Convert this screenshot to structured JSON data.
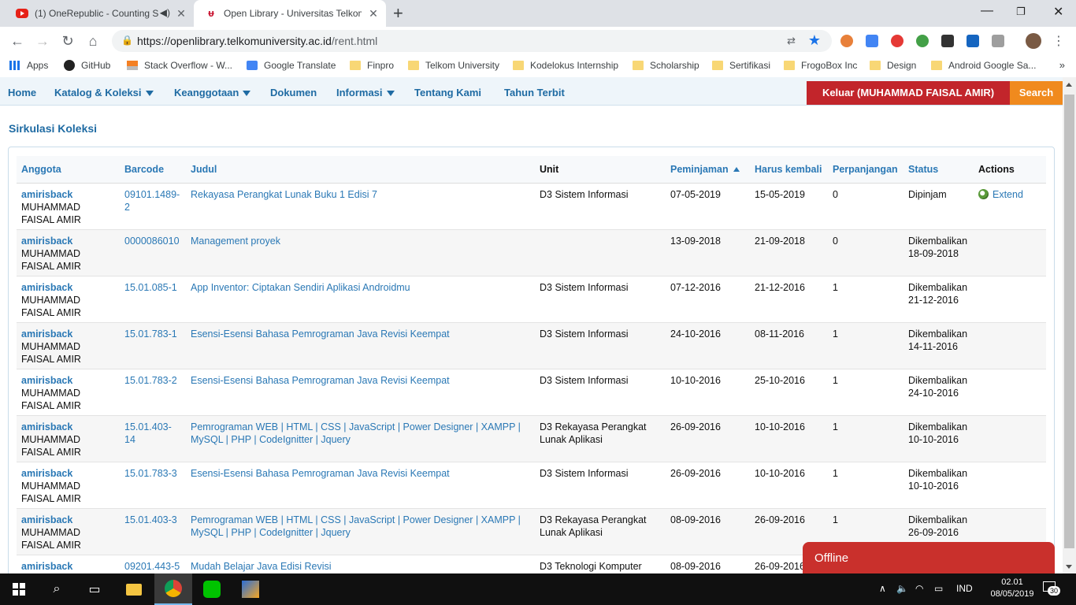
{
  "browser": {
    "tabs": [
      {
        "title": "(1) OneRepublic - Counting S",
        "favicon": "youtube-icon",
        "audio": "speaker-icon"
      },
      {
        "title": "Open Library - Universitas Telkom",
        "favicon": "telkom-icon"
      }
    ],
    "url": {
      "host": "https://openlibrary.telkomuniversity.ac.id",
      "path": "/rent.html"
    },
    "bookmarks": [
      {
        "label": "Apps",
        "icon": "apps-grid-icon"
      },
      {
        "label": "GitHub",
        "icon": "github-icon"
      },
      {
        "label": "Stack Overflow - W...",
        "icon": "stackoverflow-icon"
      },
      {
        "label": "Google Translate",
        "icon": "google-translate-icon"
      },
      {
        "label": "Finpro",
        "icon": "folder-icon"
      },
      {
        "label": "Telkom University",
        "icon": "folder-icon"
      },
      {
        "label": "Kodelokus Internship",
        "icon": "folder-icon"
      },
      {
        "label": "Scholarship",
        "icon": "folder-icon"
      },
      {
        "label": "Sertifikasi",
        "icon": "folder-icon"
      },
      {
        "label": "FrogoBox Inc",
        "icon": "folder-icon"
      },
      {
        "label": "Design",
        "icon": "folder-icon"
      },
      {
        "label": "Android Google Sa...",
        "icon": "folder-icon"
      }
    ],
    "bookmarks_more": "»"
  },
  "site_nav": {
    "items": [
      "Home",
      "Katalog & Koleksi",
      "Keanggotaan",
      "Dokumen",
      "Informasi",
      "Tentang Kami",
      "Tahun Terbit"
    ],
    "logout": "Keluar (MUHAMMAD FAISAL AMIR)",
    "search": "Search"
  },
  "page": {
    "title": "Sirkulasi Koleksi",
    "columns": [
      "Anggota",
      "Barcode",
      "Judul",
      "Unit",
      "Peminjaman",
      "Harus kembali",
      "Perpanjangan",
      "Status",
      "Actions"
    ],
    "rows": [
      {
        "user": "amirisback",
        "name": "MUHAMMAD FAISAL AMIR",
        "barcode": "09101.1489-2",
        "title": "Rekayasa Perangkat Lunak Buku 1 Edisi 7",
        "unit": "D3 Sistem Informasi",
        "borrowed": "07-05-2019",
        "due": "15-05-2019",
        "ext": "0",
        "status": "Dipinjam",
        "action": "Extend"
      },
      {
        "user": "amirisback",
        "name": "MUHAMMAD FAISAL AMIR",
        "barcode": "0000086010",
        "title": "Management proyek",
        "unit": "",
        "borrowed": "13-09-2018",
        "due": "21-09-2018",
        "ext": "0",
        "status": "Dikembalikan 18-09-2018",
        "action": ""
      },
      {
        "user": "amirisback",
        "name": "MUHAMMAD FAISAL AMIR",
        "barcode": "15.01.085-1",
        "title": "App Inventor: Ciptakan Sendiri Aplikasi Androidmu",
        "unit": "D3 Sistem Informasi",
        "borrowed": "07-12-2016",
        "due": "21-12-2016",
        "ext": "1",
        "status": "Dikembalikan 21-12-2016",
        "action": ""
      },
      {
        "user": "amirisback",
        "name": "MUHAMMAD FAISAL AMIR",
        "barcode": "15.01.783-1",
        "title": "Esensi-Esensi Bahasa Pemrograman Java Revisi Keempat",
        "unit": "D3 Sistem Informasi",
        "borrowed": "24-10-2016",
        "due": "08-11-2016",
        "ext": "1",
        "status": "Dikembalikan 14-11-2016",
        "action": ""
      },
      {
        "user": "amirisback",
        "name": "MUHAMMAD FAISAL AMIR",
        "barcode": "15.01.783-2",
        "title": "Esensi-Esensi Bahasa Pemrograman Java Revisi Keempat",
        "unit": "D3 Sistem Informasi",
        "borrowed": "10-10-2016",
        "due": "25-10-2016",
        "ext": "1",
        "status": "Dikembalikan 24-10-2016",
        "action": ""
      },
      {
        "user": "amirisback",
        "name": "MUHAMMAD FAISAL AMIR",
        "barcode": "15.01.403-14",
        "title": "Pemrograman WEB | HTML | CSS | JavaScript | Power Designer | XAMPP | MySQL | PHP | CodeIgnitter | Jquery",
        "unit": "D3 Rekayasa Perangkat Lunak Aplikasi",
        "borrowed": "26-09-2016",
        "due": "10-10-2016",
        "ext": "1",
        "status": "Dikembalikan 10-10-2016",
        "action": ""
      },
      {
        "user": "amirisback",
        "name": "MUHAMMAD FAISAL AMIR",
        "barcode": "15.01.783-3",
        "title": "Esensi-Esensi Bahasa Pemrograman Java Revisi Keempat",
        "unit": "D3 Sistem Informasi",
        "borrowed": "26-09-2016",
        "due": "10-10-2016",
        "ext": "1",
        "status": "Dikembalikan 10-10-2016",
        "action": ""
      },
      {
        "user": "amirisback",
        "name": "MUHAMMAD FAISAL AMIR",
        "barcode": "15.01.403-3",
        "title": "Pemrograman WEB | HTML | CSS | JavaScript | Power Designer | XAMPP | MySQL | PHP | CodeIgnitter | Jquery",
        "unit": "D3 Rekayasa Perangkat Lunak Aplikasi",
        "borrowed": "08-09-2016",
        "due": "26-09-2016",
        "ext": "1",
        "status": "Dikembalikan 26-09-2016",
        "action": ""
      },
      {
        "user": "amirisback",
        "name": "",
        "barcode": "09201.443-5",
        "title": "Mudah Belajar Java Edisi Revisi",
        "unit": "D3 Teknologi Komputer",
        "borrowed": "08-09-2016",
        "due": "26-09-2016",
        "ext": "",
        "status": "",
        "action": ""
      }
    ],
    "offline_label": "Offline"
  },
  "taskbar": {
    "language": "IND",
    "time": "02.01",
    "date": "08/05/2019",
    "notifications": "30"
  },
  "colors": {
    "link": "#2a78b5",
    "nav_bg": "#eef5fa",
    "logout_bg": "#c2252b",
    "search_bg": "#f08a1e",
    "offline_bg": "#c9302c"
  }
}
